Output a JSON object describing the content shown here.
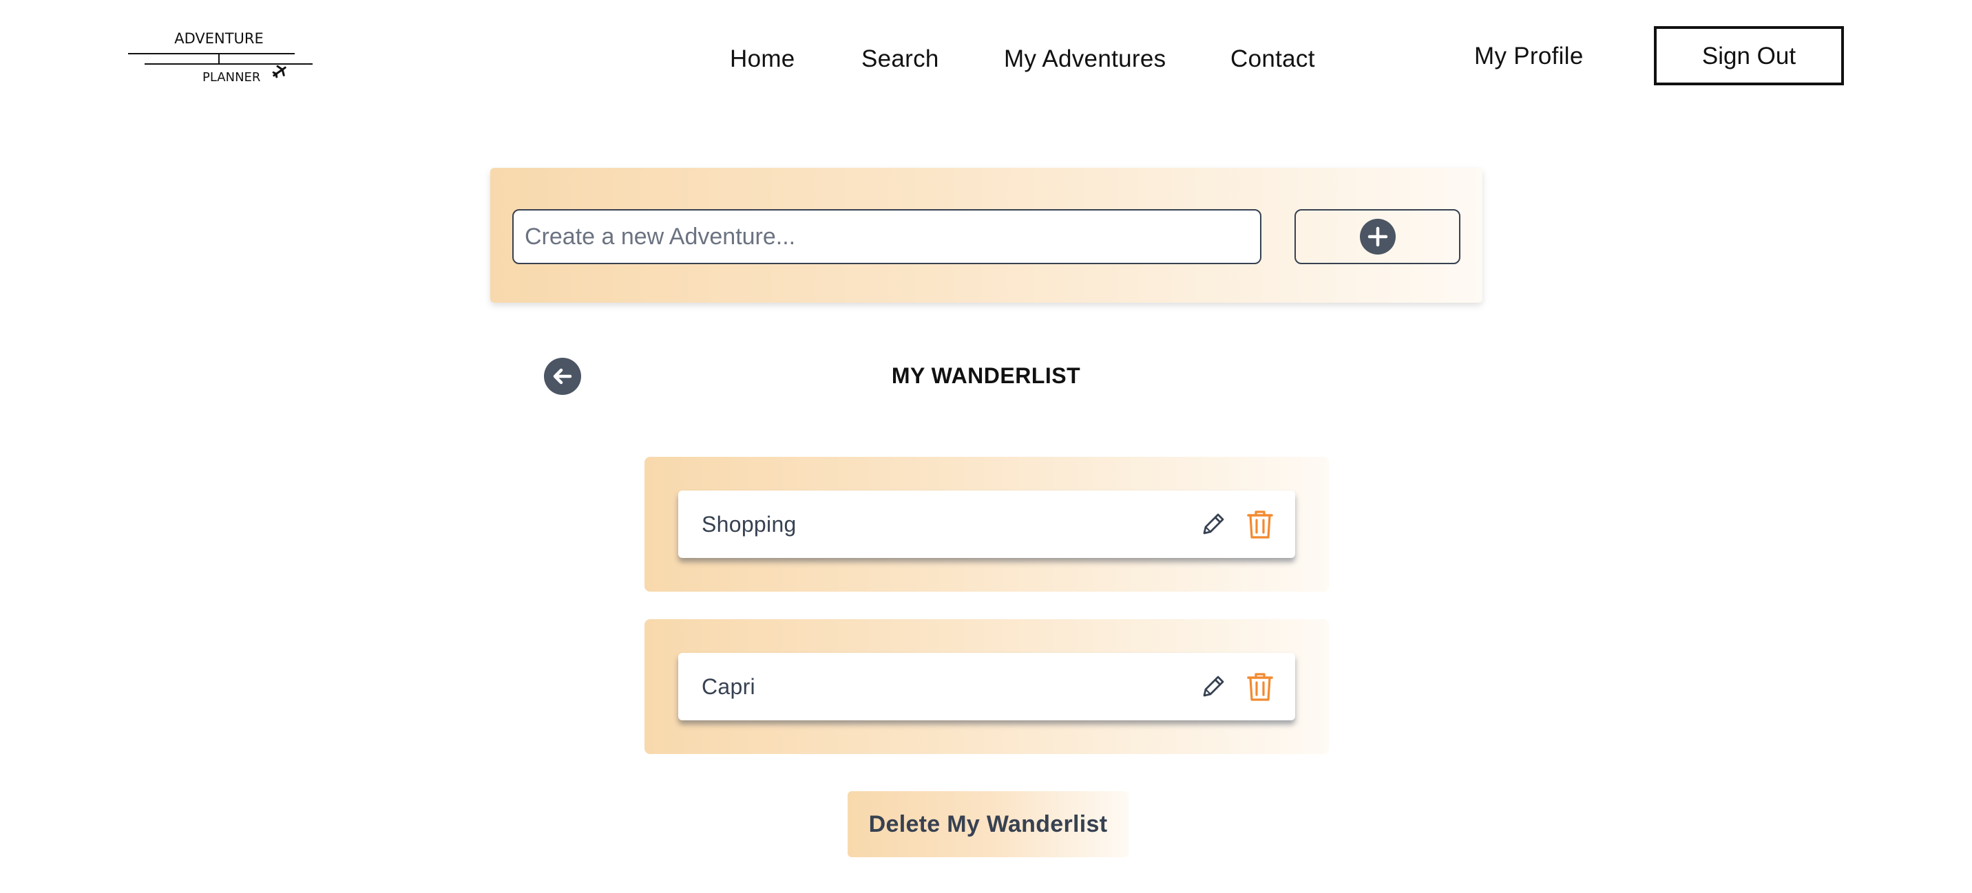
{
  "logo": {
    "line1": "ADVENTURE",
    "line2": "PLANNER",
    "icon": "airplane-icon"
  },
  "nav": {
    "items": [
      {
        "label": "Home"
      },
      {
        "label": "Search"
      },
      {
        "label": "My Adventures"
      },
      {
        "label": "Contact"
      }
    ],
    "profile_label": "My Profile",
    "signout_label": "Sign Out"
  },
  "create": {
    "placeholder": "Create a new Adventure...",
    "value": "",
    "add_icon": "plus-circle-icon"
  },
  "wanderlist": {
    "title": "MY WANDERLIST",
    "back_icon": "arrow-left-circle-icon",
    "items": [
      {
        "name": "Shopping"
      },
      {
        "name": "Capri"
      }
    ],
    "delete_all_label": "Delete My Wanderlist"
  },
  "colors": {
    "accent_orange": "#f28a30",
    "dark_icon": "#4b5563",
    "card_gradient_start": "#f8d9ad",
    "card_gradient_end": "#fefaf4",
    "text_dark": "#374151"
  }
}
